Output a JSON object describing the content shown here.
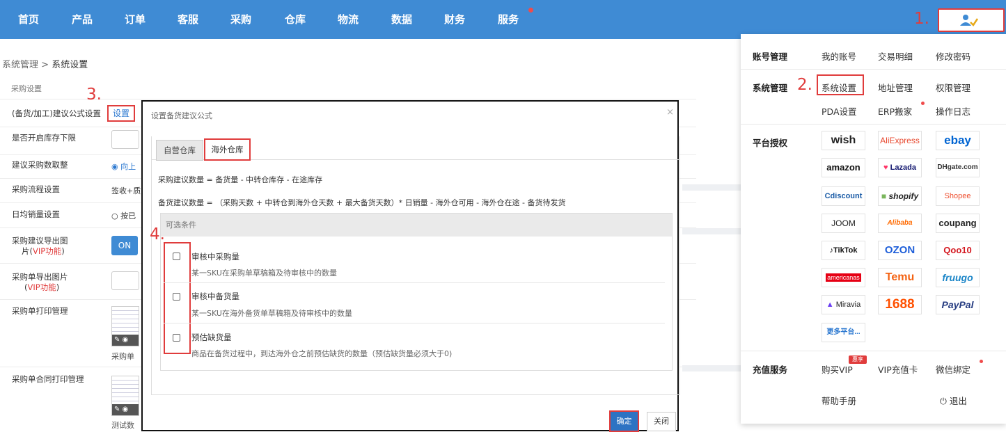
{
  "nav": [
    "首页",
    "产品",
    "订单",
    "客服",
    "采购",
    "仓库",
    "物流",
    "数据",
    "财务",
    "服务"
  ],
  "annotations": {
    "n1": "1.",
    "n2": "2.",
    "n3": "3.",
    "n4": "4."
  },
  "breadcrumb": {
    "parent": "系统管理",
    "sep": " > ",
    "current": "系统设置"
  },
  "settings": {
    "section": "采购设置",
    "rows": {
      "formula": "(备货/加工)建议公式设置",
      "stock_limit": "是否开启库存下限",
      "rounding": "建议采购数取整",
      "process": "采购流程设置",
      "daily_sales": "日均销量设置",
      "export_img_1": "采购建议导出图",
      "export_img_2": "片(",
      "export_img_vip": "VIP功能",
      "export_img_close": ")",
      "order_img": "采购单导出图片",
      "order_img_open": "(",
      "order_img_vip": "VIP功能",
      "order_img_close": ")",
      "print": "采购单打印管理",
      "contract_print": "采购单合同打印管理"
    },
    "set_link": "设置",
    "round_option": "◉ 向上",
    "process_value": "签收+质",
    "daily_option": "○ 按已",
    "on_label": "ON",
    "print_caption": "采购单",
    "contract_caption": "测试数"
  },
  "modal": {
    "title": "设置备货建议公式",
    "close": "×",
    "tabs": [
      "自营仓库",
      "海外仓库"
    ],
    "formula1": "采购建议数量 = 备货量 - 中转仓库存 - 在途库存",
    "formula2": "备货建议数量 = （采购天数 + 中转仓到海外仓天数 + 最大备货天数）* 日销量 - 海外仓可用 - 海外仓在途 - 备货待发货",
    "options_header": "可选条件",
    "options": [
      {
        "name": "审核中采购量",
        "desc": "某一SKU在采购单草稿箱及待审核中的数量"
      },
      {
        "name": "审核中备货量",
        "desc": "某一SKU在海外备货单草稿箱及待审核中的数量"
      },
      {
        "name": "预估缺货量",
        "desc": "商品在备货过程中，到达海外仓之前预估缺货的数量（预估缺货量必须大于0)"
      }
    ],
    "confirm": "确定",
    "cancel": "关闭"
  },
  "dropdown": {
    "account_head": "账号管理",
    "account_items": [
      "我的账号",
      "交易明细",
      "修改密码"
    ],
    "system_head": "系统管理",
    "system_items": [
      "系统设置",
      "地址管理",
      "权限管理",
      "PDA设置",
      "ERP搬家",
      "操作日志"
    ],
    "platform_head": "平台授权",
    "platforms": [
      "wish",
      "AliExpress",
      "ebay",
      "amazon",
      "Lazada",
      "DHgate.com",
      "Cdiscount",
      "shopify",
      "Shopee",
      "JOOM",
      "Alibaba",
      "coupang",
      "TikTok",
      "OZON",
      "Qoo10",
      "americanas",
      "Temu",
      "fruugo",
      "Miravia",
      "1688",
      "PayPal",
      "更多平台..."
    ],
    "recharge_head": "充值服务",
    "recharge_items": [
      "购买VIP",
      "VIP充值卡",
      "微信绑定"
    ],
    "vip_badge": "惠享",
    "help": "帮助手册",
    "logout": "退出"
  },
  "colors": {
    "nav": "#3f8bd4",
    "highlight": "#e03c3c",
    "primary": "#2d73c3"
  }
}
